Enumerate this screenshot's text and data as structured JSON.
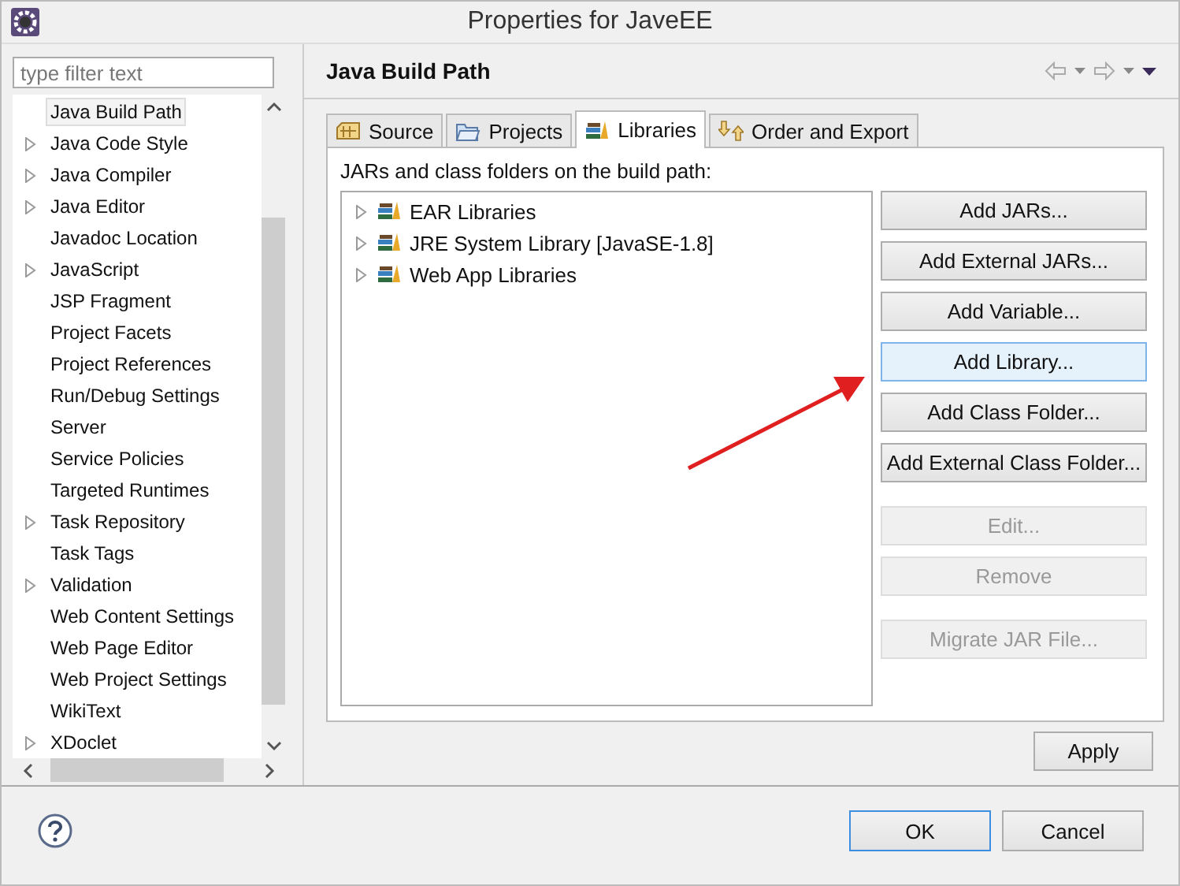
{
  "window": {
    "title": "Properties for JaveEE"
  },
  "filter": {
    "placeholder": "type filter text"
  },
  "sidebar": {
    "items": [
      {
        "label": "Java Build Path",
        "expandable": false,
        "selected": true
      },
      {
        "label": "Java Code Style",
        "expandable": true,
        "selected": false
      },
      {
        "label": "Java Compiler",
        "expandable": true,
        "selected": false
      },
      {
        "label": "Java Editor",
        "expandable": true,
        "selected": false
      },
      {
        "label": "Javadoc Location",
        "expandable": false,
        "selected": false
      },
      {
        "label": "JavaScript",
        "expandable": true,
        "selected": false
      },
      {
        "label": "JSP Fragment",
        "expandable": false,
        "selected": false
      },
      {
        "label": "Project Facets",
        "expandable": false,
        "selected": false
      },
      {
        "label": "Project References",
        "expandable": false,
        "selected": false
      },
      {
        "label": "Run/Debug Settings",
        "expandable": false,
        "selected": false
      },
      {
        "label": "Server",
        "expandable": false,
        "selected": false
      },
      {
        "label": "Service Policies",
        "expandable": false,
        "selected": false
      },
      {
        "label": "Targeted Runtimes",
        "expandable": false,
        "selected": false
      },
      {
        "label": "Task Repository",
        "expandable": true,
        "selected": false
      },
      {
        "label": "Task Tags",
        "expandable": false,
        "selected": false
      },
      {
        "label": "Validation",
        "expandable": true,
        "selected": false
      },
      {
        "label": "Web Content Settings",
        "expandable": false,
        "selected": false
      },
      {
        "label": "Web Page Editor",
        "expandable": false,
        "selected": false
      },
      {
        "label": "Web Project Settings",
        "expandable": false,
        "selected": false
      },
      {
        "label": "WikiText",
        "expandable": false,
        "selected": false
      },
      {
        "label": "XDoclet",
        "expandable": true,
        "selected": false
      }
    ]
  },
  "page": {
    "title": "Java Build Path",
    "tabs": [
      {
        "label": "Source",
        "kind": "source",
        "selected": false
      },
      {
        "label": "Projects",
        "kind": "folder",
        "selected": false
      },
      {
        "label": "Libraries",
        "kind": "library",
        "selected": true
      },
      {
        "label": "Order and Export",
        "kind": "order",
        "selected": false
      }
    ],
    "list_label": "JARs and class folders on the build path:",
    "libraries": [
      {
        "label": "EAR Libraries",
        "expanded": false
      },
      {
        "label": "JRE System Library [JavaSE-1.8]",
        "expanded": false
      },
      {
        "label": "Web App Libraries",
        "expanded": false
      }
    ],
    "button_groups": [
      [
        {
          "label": "Add JARs...",
          "disabled": false,
          "hovered": false
        },
        {
          "label": "Add External JARs...",
          "disabled": false,
          "hovered": false
        },
        {
          "label": "Add Variable...",
          "disabled": false,
          "hovered": false
        },
        {
          "label": "Add Library...",
          "disabled": false,
          "hovered": true
        },
        {
          "label": "Add Class Folder...",
          "disabled": false,
          "hovered": false
        },
        {
          "label": "Add External Class Folder...",
          "disabled": false,
          "hovered": false
        }
      ],
      [
        {
          "label": "Edit...",
          "disabled": true,
          "hovered": false
        },
        {
          "label": "Remove",
          "disabled": true,
          "hovered": false
        }
      ],
      [
        {
          "label": "Migrate JAR File...",
          "disabled": true,
          "hovered": false
        }
      ]
    ],
    "apply": "Apply"
  },
  "footer": {
    "buttons": [
      {
        "label": "OK",
        "focused": true
      },
      {
        "label": "Cancel",
        "focused": false
      }
    ]
  }
}
